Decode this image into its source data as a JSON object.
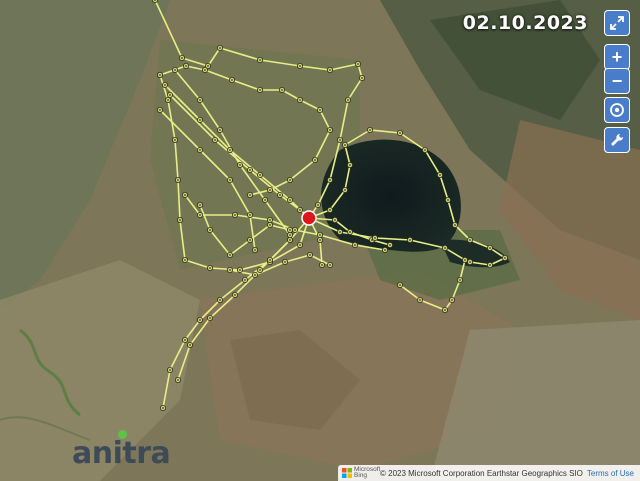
{
  "map": {
    "date": "02.10.2023",
    "current_position_color": "#e0161e",
    "track_color": "#e8ee86",
    "controls": {
      "fullscreen": "expand-icon",
      "zoom_in": "+",
      "zoom_out": "−",
      "locate": "target-icon",
      "settings": "wrench-icon"
    }
  },
  "logo": {
    "text": "anitra"
  },
  "attribution": {
    "provider": "Microsoft Bing",
    "text": "© 2023 Microsoft Corporation Earthstar Geographics SIO",
    "terms": "Terms of Use"
  }
}
